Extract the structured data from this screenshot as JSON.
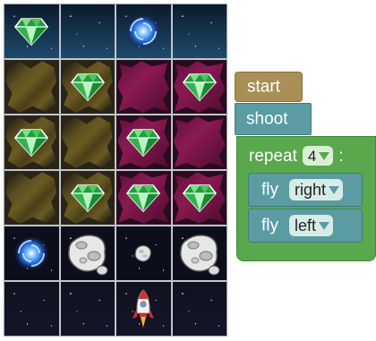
{
  "grid": {
    "rows": [
      [
        "gem",
        "empty",
        "vortex",
        "empty"
      ],
      [
        "olive-terrain",
        "olive-terrain+gem",
        "magenta-terrain",
        "magenta-terrain+gem"
      ],
      [
        "olive-terrain+gem",
        "olive-terrain",
        "magenta-terrain+gem",
        "magenta-terrain"
      ],
      [
        "olive-terrain",
        "olive-terrain+gem",
        "magenta-terrain+gem",
        "magenta-terrain+gem"
      ],
      [
        "vortex",
        "asteroid",
        "small-asteroid",
        "asteroid"
      ],
      [
        "empty",
        "empty",
        "rocket",
        "empty"
      ]
    ]
  },
  "blocks": {
    "start_label": "start",
    "shoot_label": "shoot",
    "repeat_label": "repeat",
    "repeat_count": "4",
    "colon": ":",
    "fly_label": "fly",
    "fly1_direction": "right",
    "fly2_direction": "left"
  }
}
